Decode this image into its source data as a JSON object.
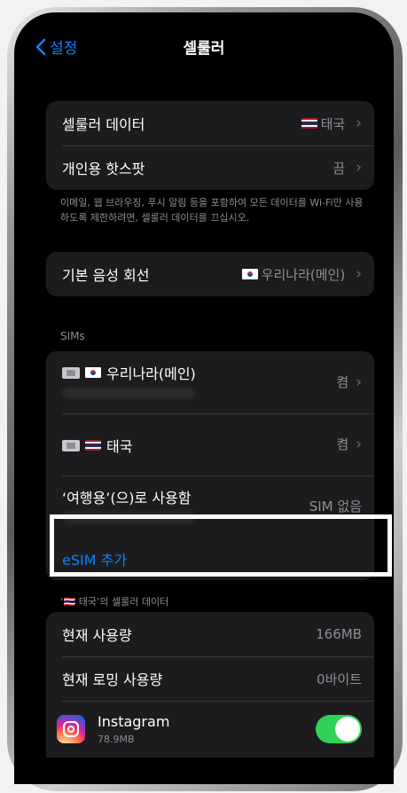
{
  "nav": {
    "back_label": "설정",
    "title": "셀룰러"
  },
  "group1": {
    "cellular_data_label": "셀룰러 데이터",
    "cellular_data_value": "태국",
    "hotspot_label": "개인용 핫스팟",
    "hotspot_value": "끔"
  },
  "footnote1": "이메일, 웹 브라우징, 푸시 알림 등을 포함하여 모든 데이터를 Wi-Fi만 사용하도록 제한하려면, 셀룰러 데이터를 끄십시오.",
  "voice": {
    "label": "기본 음성 회선",
    "value": "우리나라(메인)"
  },
  "sims": {
    "header": "SIMs",
    "korea_label": "우리나라(메인)",
    "korea_status": "켬",
    "thai_label": "태국",
    "thai_status": "켬",
    "travel_label": "‘여행용’(으)로 사용함",
    "travel_status": "SIM 없음",
    "add_esim": "eSIM 추가"
  },
  "usage": {
    "header": "‘🇹🇭 태국’의 셀룰러 데이터",
    "current_label": "현재 사용량",
    "current_value": "166MB",
    "roaming_label": "현재 로밍 사용량",
    "roaming_value": "0바이트"
  },
  "app": {
    "name": "Instagram",
    "size": "78.9MB",
    "enabled": true
  }
}
